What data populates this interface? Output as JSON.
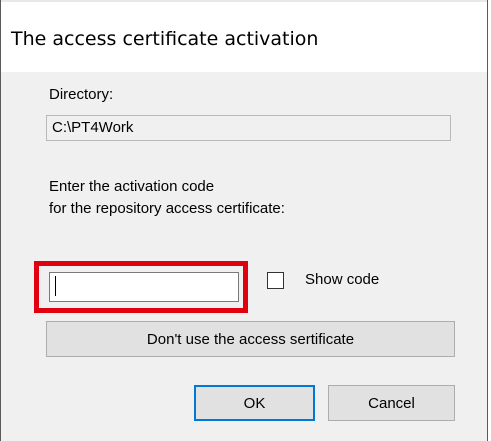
{
  "window": {
    "title": "The access certificate activation"
  },
  "directory": {
    "label": "Directory:",
    "value": "C:\\PT4Work"
  },
  "prompt": {
    "line1": "Enter the activation code",
    "line2": "for the repository access certificate:"
  },
  "activation_code": {
    "value": "",
    "placeholder": ""
  },
  "show_code": {
    "label": "Show code",
    "checked": false
  },
  "buttons": {
    "no_certificate": "Don't use the access sertificate",
    "ok": "OK",
    "cancel": "Cancel"
  },
  "colors": {
    "highlight": "#e0000f",
    "default_button_border": "#0078d7",
    "dialog_background": "#f0f0f0"
  }
}
